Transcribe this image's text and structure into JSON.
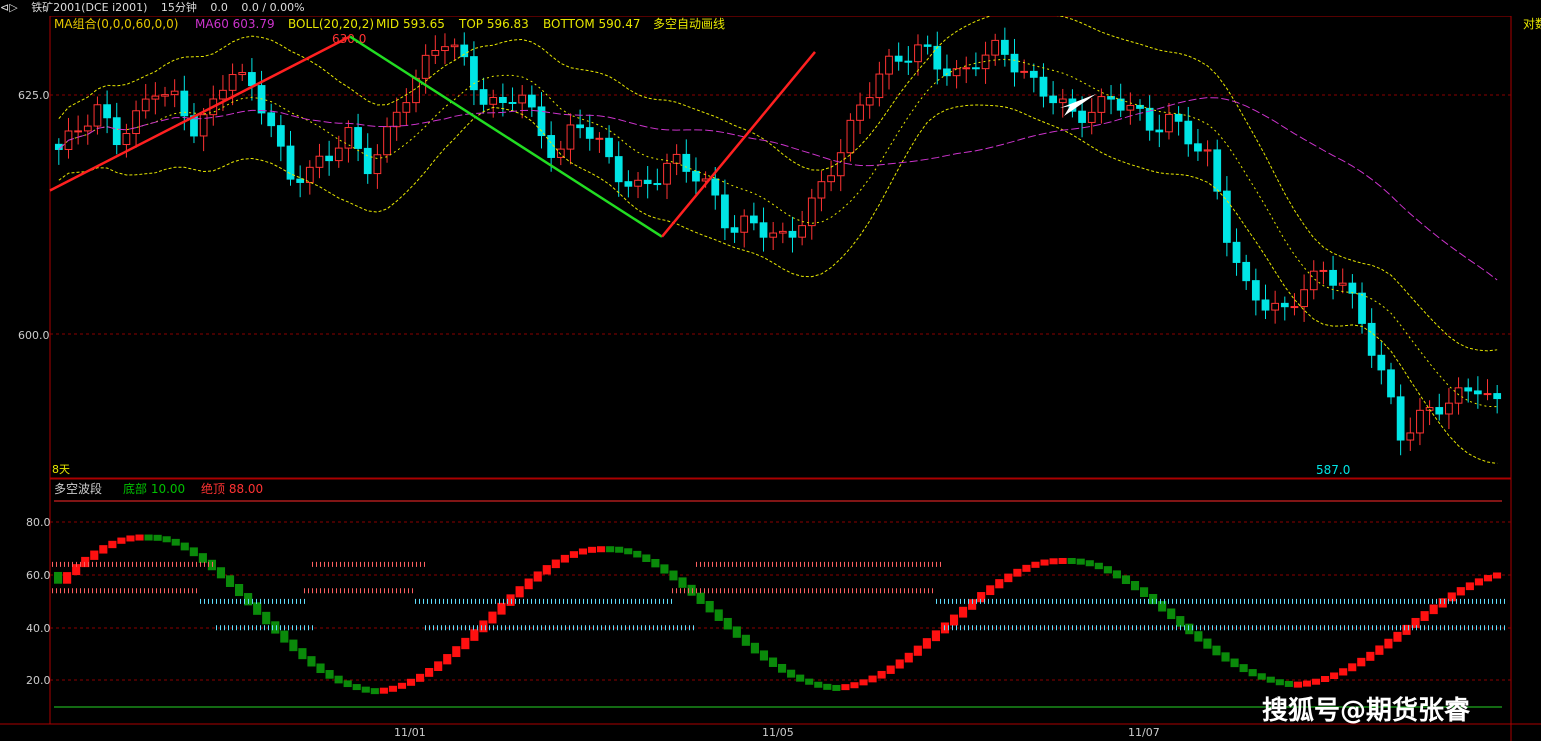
{
  "header": {
    "icon": "back-arrow-icon",
    "symbol": "铁矿2001(DCE i2001)",
    "period": "15分钟",
    "change": "0.0",
    "change_pct": "0.0 / 0.00%"
  },
  "indicators": {
    "ma_label": "MA组合(0,0,0,60,0,0)",
    "ma60": "MA60 603.79",
    "boll": "BOLL(20,20,2)",
    "mid": "MID 593.65",
    "top": "TOP 596.83",
    "bottom": "BOTTOM 590.47",
    "auto_draw": "多空自动画线",
    "right_label": "对数"
  },
  "main_chart": {
    "days_label": "8天",
    "high_label": "630.0",
    "low_label": "587.0",
    "y_ticks": [
      "625.0",
      "600.0"
    ]
  },
  "sub_chart": {
    "title": "多空波段",
    "bottom_label": "底部 10.00",
    "top_label": "绝顶 88.00",
    "y_ticks": [
      "80.0",
      "60.0",
      "40.0",
      "20.0"
    ]
  },
  "x_axis": {
    "ticks": [
      "11/01",
      "11/05",
      "11/07"
    ]
  },
  "watermark": "搜狐号@期货张睿",
  "colors": {
    "up": "#ff3333",
    "down": "#00e5e5",
    "boll": "#e6e600",
    "ma60": "#cc33cc",
    "green": "#0a8a0a"
  },
  "chart_data": [
    {
      "type": "candlestick",
      "ylim": [
        587,
        632
      ],
      "close_path": [
        619,
        621,
        623,
        620,
        622,
        625,
        624,
        621,
        623,
        627,
        625,
        622,
        616,
        617,
        618,
        621,
        617,
        620,
        624,
        627,
        630,
        628,
        624,
        623,
        625,
        621,
        618,
        622,
        620,
        617,
        615,
        616,
        618,
        617,
        615,
        611,
        612,
        611,
        610,
        613,
        616,
        620,
        624,
        627,
        628,
        629,
        627,
        626,
        628,
        629,
        627,
        625,
        624,
        622,
        623,
        624,
        623,
        621,
        622,
        620,
        618,
        610,
        605,
        604,
        603,
        606,
        607,
        606,
        602,
        597,
        591,
        593,
        594,
        595,
        596,
        594
      ]
    },
    {
      "type": "area",
      "ylim": [
        10,
        88
      ],
      "x_count": 160,
      "green_line": 10,
      "top_line": 88
    }
  ]
}
